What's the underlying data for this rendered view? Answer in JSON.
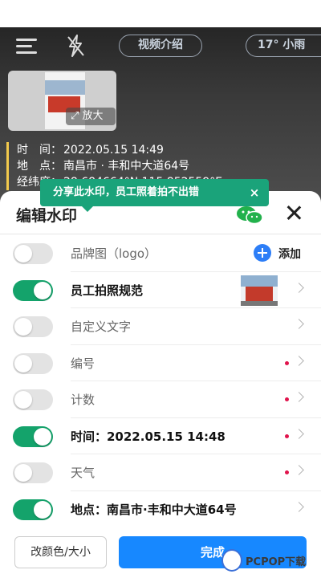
{
  "header": {
    "video_intro": "视频介绍",
    "weather": "17° 小雨"
  },
  "thumbnail": {
    "zoom_label": "放大"
  },
  "watermark_preview": {
    "time_key": "时　间：",
    "time_value": "2022.05.15 14:49",
    "place_key": "地　点：",
    "place_value": "南昌市 · 丰和中大道64号",
    "coord_key": "经纬度：",
    "coord_value": "28.684664°N,115.852559°E"
  },
  "toast": {
    "text": "分享此水印，员工照着拍不出错",
    "close": "×"
  },
  "sheet": {
    "title": "编辑水印",
    "rows": [
      {
        "label": "品牌图（logo）",
        "on": false,
        "action": "添加"
      },
      {
        "label": "员工拍照规范",
        "on": true
      },
      {
        "label": "自定义文字",
        "on": false
      },
      {
        "label": "编号",
        "on": false
      },
      {
        "label": "计数",
        "on": false
      },
      {
        "label": "时间：2022.05.15 14:48",
        "on": true
      },
      {
        "label": "天气",
        "on": false
      },
      {
        "label": "地点：南昌市·丰和中大道64号",
        "on": true
      }
    ]
  },
  "footer": {
    "color_size": "改颜色/大小",
    "done": "完成"
  },
  "brand_watermark": "PCPOP下载",
  "colors": {
    "toggle_on": "#14a36b",
    "primary": "#1788ff",
    "toast": "#1aa37a",
    "dot": "#e0144c"
  }
}
